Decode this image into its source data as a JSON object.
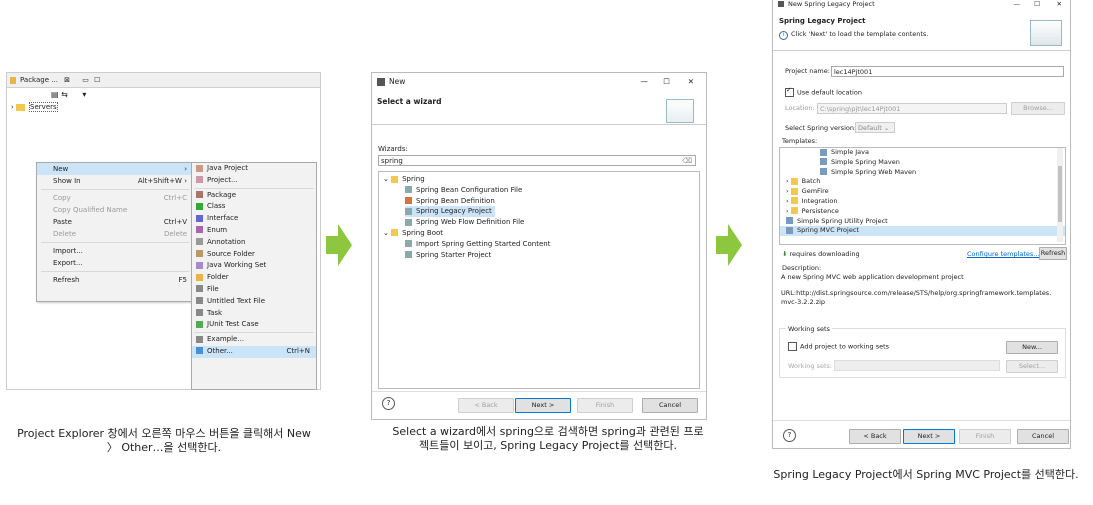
{
  "panel1": {
    "tab_label": "Package ...",
    "tab_close": "⊠",
    "tree_item": "Servers",
    "context_menu": [
      {
        "label": "New",
        "shortcut": "",
        "arrow": "›",
        "state": "hl"
      },
      {
        "label": "Show In",
        "shortcut": "Alt+Shift+W ›",
        "state": ""
      },
      {
        "label": "Copy",
        "shortcut": "Ctrl+C",
        "state": "dis"
      },
      {
        "label": "Copy Qualified Name",
        "shortcut": "",
        "state": "dis"
      },
      {
        "label": "Paste",
        "shortcut": "Ctrl+V",
        "state": ""
      },
      {
        "label": "Delete",
        "shortcut": "Delete",
        "state": "dis"
      },
      {
        "label": "Import...",
        "shortcut": "",
        "state": ""
      },
      {
        "label": "Export...",
        "shortcut": "",
        "state": ""
      },
      {
        "label": "Refresh",
        "shortcut": "F5",
        "state": ""
      }
    ],
    "submenu": [
      "Java Project",
      "Project...",
      "Package",
      "Class",
      "Interface",
      "Enum",
      "Annotation",
      "Source Folder",
      "Java Working Set",
      "Folder",
      "File",
      "Untitled Text File",
      "Task",
      "JUnit Test Case",
      "Example...",
      "Other..."
    ],
    "other_shortcut": "Ctrl+N"
  },
  "panel2": {
    "title": "New",
    "header": "Select a wizard",
    "wizards_label": "Wizards:",
    "filter_value": "spring",
    "tree": [
      {
        "label": "Spring",
        "level": 0,
        "folder": true
      },
      {
        "label": "Spring Bean Configuration File",
        "level": 1
      },
      {
        "label": "Spring Bean Definition",
        "level": 1
      },
      {
        "label": "Spring Legacy Project",
        "level": 1,
        "selected": true
      },
      {
        "label": "Spring Web Flow Definition File",
        "level": 1
      },
      {
        "label": "Spring Boot",
        "level": 0,
        "folder": true
      },
      {
        "label": "Import Spring Getting Started Content",
        "level": 1
      },
      {
        "label": "Spring Starter Project",
        "level": 1
      }
    ],
    "buttons": {
      "back": "< Back",
      "next": "Next >",
      "finish": "Finish",
      "cancel": "Cancel"
    },
    "help": "?"
  },
  "panel3": {
    "title": "New Spring Legacy Project",
    "header": "Spring Legacy Project",
    "info": "Click 'Next' to load the template contents.",
    "project_name_label": "Project name:",
    "project_name_value": "lec14Pjt001",
    "use_default_location": "Use default location",
    "location_label": "Location:",
    "location_value": "C:\\spring\\pjt\\lec14Pjt001",
    "browse": "Browse...",
    "spring_version_label": "Select Spring version:",
    "spring_version_value": "Default",
    "templates_label": "Templates:",
    "templates": [
      {
        "label": "Simple Java",
        "indent": 2
      },
      {
        "label": "Simple Spring Maven",
        "indent": 2
      },
      {
        "label": "Simple Spring Web Maven",
        "indent": 2
      },
      {
        "label": "Batch",
        "indent": 1,
        "folder": true
      },
      {
        "label": "GemFire",
        "indent": 1,
        "folder": true
      },
      {
        "label": "Integration",
        "indent": 1,
        "folder": true
      },
      {
        "label": "Persistence",
        "indent": 1,
        "folder": true
      },
      {
        "label": "Simple Spring Utility Project",
        "indent": 1
      },
      {
        "label": "Spring MVC Project",
        "indent": 1,
        "selected": true
      }
    ],
    "requires_downloading": "requires downloading",
    "configure_templates": "Configure templates...",
    "refresh": "Refresh",
    "description_label": "Description:",
    "description_text": "A new Spring MVC web application development project",
    "url_text": "URL:http://dist.springsource.com/release/STS/help/org.springframework.templates.mvc-3.2.2.zip",
    "working_sets_label": "Working sets",
    "add_working_sets": "Add project to working sets",
    "working_sets_field_label": "Working sets:",
    "new_btn": "New...",
    "select_btn": "Select...",
    "buttons": {
      "back": "< Back",
      "next": "Next >",
      "finish": "Finish",
      "cancel": "Cancel"
    },
    "help": "?"
  },
  "captions": {
    "c1": "Project Explorer 창에서 오른쪽 마우스 버튼을 클릭해서 New 〉 Other…을 선택한다.",
    "c2": "Select a wizard에서 spring으로 검색하면 spring과 관련된 프로젝트들이 보이고, Spring Legacy Project를 선택한다.",
    "c3": "Spring Legacy Project에서 Spring MVC Project를 선택한다."
  },
  "colors": {
    "arrow": "#8dc63f",
    "selection": "#cce4f7",
    "link": "#0066cc"
  }
}
